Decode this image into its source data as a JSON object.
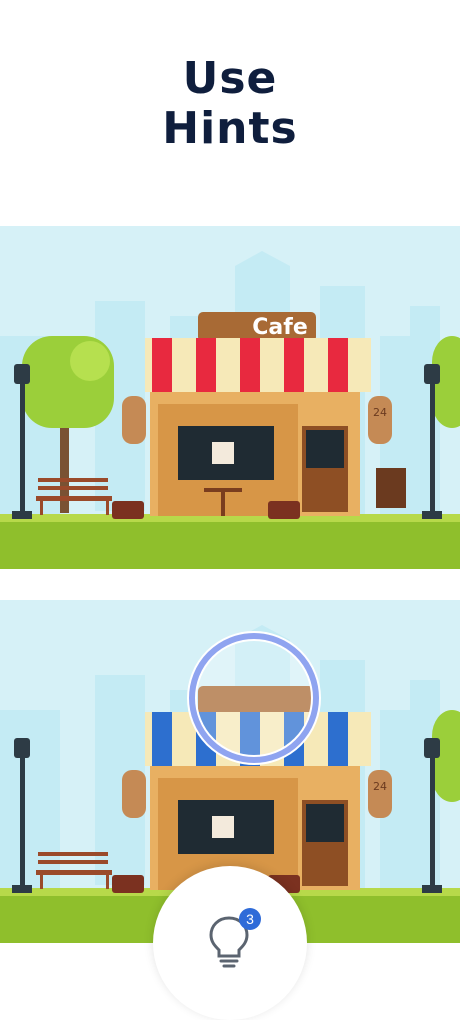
{
  "title": {
    "line1": "Use",
    "line2": "Hints"
  },
  "scene_top": {
    "sign_text": "Cafe",
    "hours_badge": "24",
    "awning_colors": [
      "#e8293f",
      "#f6e9b8"
    ]
  },
  "scene_bottom": {
    "hours_badge": "24",
    "awning_colors": [
      "#2d6fcf",
      "#f6e9b8"
    ]
  },
  "hint_button": {
    "icon": "lightbulb-icon",
    "count": "3"
  },
  "colors": {
    "title": "#0f1e3d",
    "hint_ring": "#8fa4f0",
    "badge": "#2f6bd8"
  }
}
